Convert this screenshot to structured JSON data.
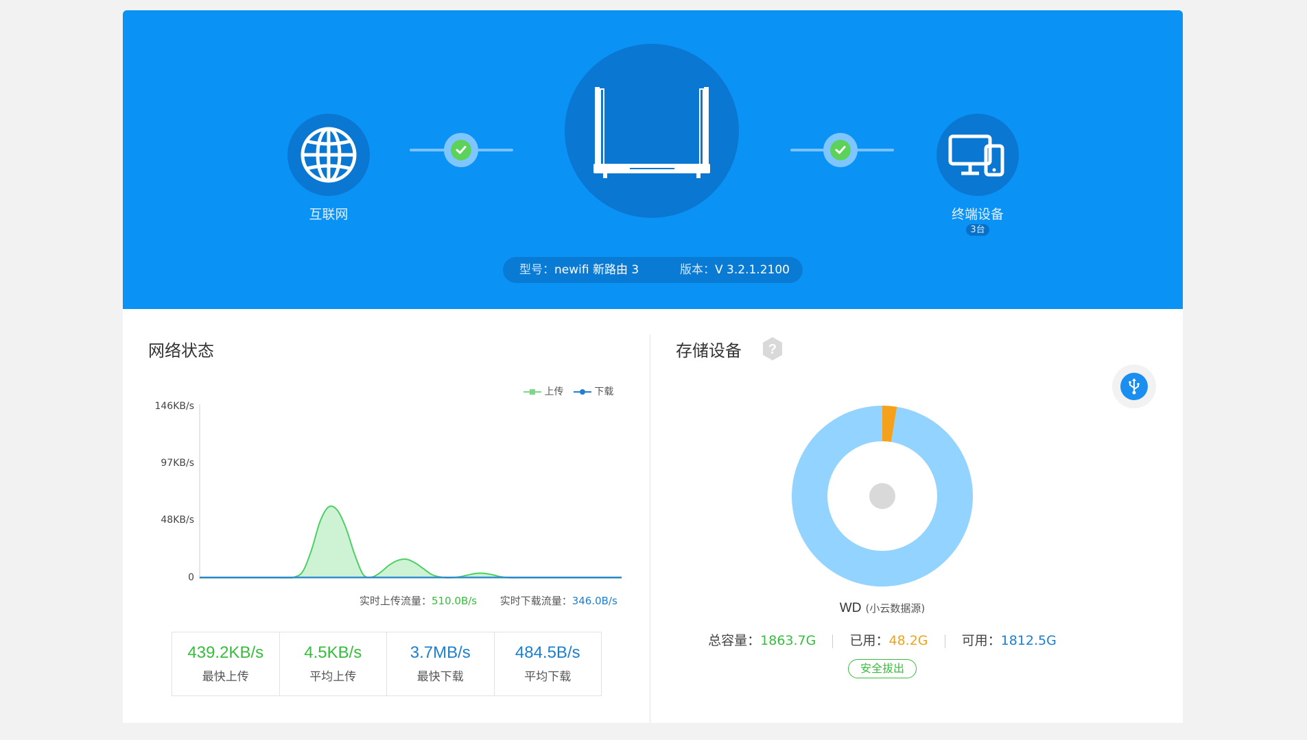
{
  "hero": {
    "internet_label": "互联网",
    "devices_label": "终端设备",
    "devices_count": "3台",
    "model_label": "型号：",
    "model_value": "newifi 新路由 3",
    "version_label": "版本：",
    "version_value": "V 3.2.1.2100",
    "colors": {
      "background": "#0b92f5",
      "status_ok": "#5dd25b"
    },
    "icons": [
      "globe-icon",
      "router-icon",
      "devices-icon",
      "check-icon"
    ]
  },
  "network": {
    "title": "网络状态",
    "legend_upload": "上传",
    "legend_download": "下载",
    "rt_upload_label": "实时上传流量：",
    "rt_upload_value": "510.0B/s",
    "rt_download_label": "实时下载流量：",
    "rt_download_value": "346.0B/s",
    "stats": [
      {
        "value": "439.2KB/s",
        "label": "最快上传"
      },
      {
        "value": "4.5KB/s",
        "label": "平均上传"
      },
      {
        "value": "3.7MB/s",
        "label": "最快下载"
      },
      {
        "value": "484.5B/s",
        "label": "平均下载"
      }
    ]
  },
  "storage": {
    "title": "存储设备",
    "device_name": "WD",
    "device_sub": "(小云数据源)",
    "total_label": "总容量：",
    "total_value": "1863.7G",
    "used_label": "已用：",
    "used_value": "48.2G",
    "free_label": "可用：",
    "free_value": "1812.5G",
    "eject_label": "安全拔出",
    "icons": [
      "help-icon",
      "usb-icon"
    ]
  },
  "chart_data": [
    {
      "type": "area",
      "title": "",
      "xlabel": "",
      "ylabel": "",
      "y_ticks": [
        "146KB/s",
        "97KB/s",
        "48KB/s",
        "0"
      ],
      "ylim": [
        0,
        146
      ],
      "y_unit": "KB/s",
      "grid": false,
      "legend": "top-right",
      "x": [
        0,
        1,
        2,
        3,
        4,
        5,
        6,
        7,
        8,
        9,
        10,
        11,
        12,
        13,
        14,
        15,
        16,
        17,
        18,
        19,
        20,
        21,
        22,
        23,
        24,
        25,
        26,
        27,
        28,
        29,
        30,
        31,
        32,
        33,
        34,
        35,
        36,
        37,
        38,
        39,
        40,
        41,
        42,
        43,
        44,
        45,
        46,
        47,
        48,
        49
      ],
      "series": [
        {
          "name": "上传",
          "color": "#4cd064",
          "values": [
            0.5,
            0.5,
            0.5,
            0.5,
            0.5,
            0.5,
            0.5,
            0.5,
            0.5,
            0.5,
            0.5,
            1,
            6,
            24,
            48,
            60,
            57,
            42,
            20,
            3,
            1,
            5,
            11,
            15,
            16,
            13,
            8,
            3,
            1,
            0.5,
            1,
            2.5,
            4,
            4.2,
            3,
            1.2,
            0.5,
            0.5,
            0.5,
            0.5,
            0.5,
            0.5,
            0.5,
            0.5,
            0.5,
            0.5,
            0.5,
            0.5,
            0.5,
            0.5
          ]
        },
        {
          "name": "下载",
          "color": "#1f7fd6",
          "values": [
            0.8,
            0.8,
            0.8,
            0.8,
            0.8,
            0.8,
            0.8,
            0.8,
            0.8,
            0.8,
            0.8,
            0.8,
            0.8,
            0.8,
            0.8,
            0.8,
            0.8,
            0.8,
            0.8,
            0.8,
            0.8,
            0.8,
            0.8,
            0.8,
            0.8,
            0.8,
            0.8,
            0.8,
            0.8,
            0.8,
            0.8,
            0.8,
            0.8,
            0.8,
            0.8,
            0.8,
            0.8,
            0.8,
            0.8,
            0.8,
            0.8,
            0.8,
            0.8,
            0.8,
            0.8,
            0.8,
            0.8,
            0.8,
            0.8,
            0.8
          ]
        }
      ]
    },
    {
      "type": "pie",
      "title": "",
      "categories": [
        "已用",
        "可用"
      ],
      "values": [
        48.2,
        1812.5
      ],
      "colors": [
        "#f5a11c",
        "#93d3ff"
      ]
    }
  ]
}
